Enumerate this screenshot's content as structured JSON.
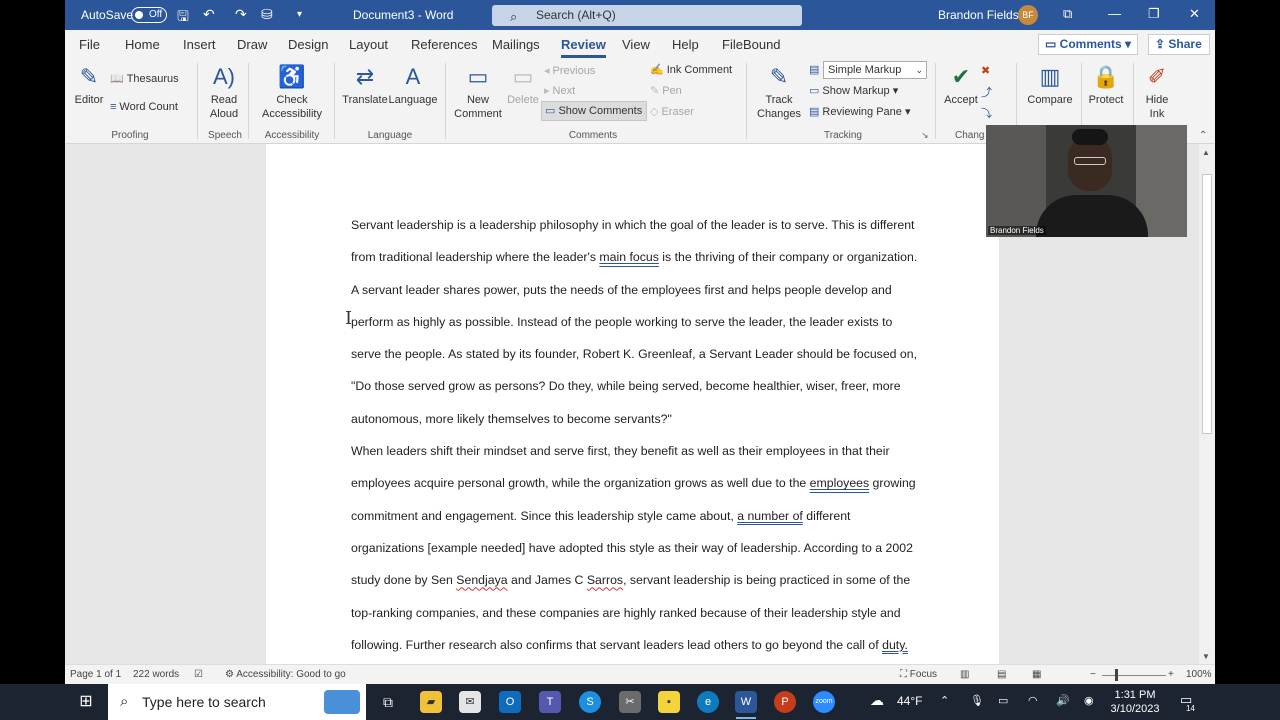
{
  "titlebar": {
    "autosave_label": "AutoSave",
    "autosave_state": "Off",
    "doc_title": "Document3 - Word",
    "search_placeholder": "Search (Alt+Q)",
    "user_name": "Brandon Fields",
    "user_initials": "BF"
  },
  "menu": {
    "tabs": [
      "File",
      "Home",
      "Insert",
      "Draw",
      "Design",
      "Layout",
      "References",
      "Mailings",
      "Review",
      "View",
      "Help",
      "FileBound"
    ],
    "active": "Review",
    "comments_label": "Comments",
    "share_label": "Share"
  },
  "ribbon": {
    "proofing": {
      "editor": "Editor",
      "thesaurus": "Thesaurus",
      "word_count": "Word Count",
      "group": "Proofing"
    },
    "speech": {
      "read_aloud_1": "Read",
      "read_aloud_2": "Aloud",
      "group": "Speech"
    },
    "accessibility": {
      "check_1": "Check",
      "check_2": "Accessibility",
      "group": "Accessibility"
    },
    "language": {
      "translate": "Translate",
      "language": "Language",
      "group": "Language"
    },
    "comments": {
      "new_1": "New",
      "new_2": "Comment",
      "delete": "Delete",
      "previous": "Previous",
      "next": "Next",
      "show_comments": "Show Comments",
      "ink_comment": "Ink Comment",
      "pen": "Pen",
      "eraser": "Eraser",
      "group": "Comments"
    },
    "tracking": {
      "track_1": "Track",
      "track_2": "Changes",
      "markup_mode": "Simple Markup",
      "show_markup": "Show Markup",
      "reviewing_pane": "Reviewing Pane",
      "group": "Tracking"
    },
    "changes": {
      "accept": "Accept",
      "group": "Chang"
    },
    "compare": {
      "label": "Compare"
    },
    "protect": {
      "label": "Protect"
    },
    "ink": {
      "hide_1": "Hide",
      "hide_2": "Ink"
    }
  },
  "document": {
    "para1_a": "Servant leadership is a leadership philosophy in which the goal of the leader is to serve. This is different from traditional leadership where the leader's ",
    "para1_b": "main focus",
    "para1_c": " is the thriving of their company or organization. A servant leader shares power, puts the needs of the employees first and helps people develop and perform as highly as possible. Instead of the people working to serve the leader, the leader exists to serve the people. As stated by its founder, Robert K. Greenleaf, a Servant Leader should be focused on, \"Do those served grow as persons? Do they, while being served, become healthier, wiser, freer, more autonomous, more likely themselves to become servants?\"",
    "para2_a": "When leaders shift their mindset and serve first, they benefit as well as their employees in that their employees acquire personal growth, while the organization grows as well due to the ",
    "para2_b": "employees",
    "para2_c": " growing commitment and engagement. Since this leadership style came about, ",
    "para2_d": "a number of",
    "para2_e": " different organizations [example needed] have adopted this style as their way of leadership. According to a 2002 study done by Sen ",
    "para2_f": "Sendjaya",
    "para2_g": " and James C ",
    "para2_h": "Sarros",
    "para2_i": ", servant leadership is being practiced in some of the top-ranking companies, and these companies are highly ranked because of their leadership style and following. Further research also confirms that servant leaders lead others to go beyond the call of ",
    "para2_j": "duty."
  },
  "webcam": {
    "name": "Brandon Fields"
  },
  "status": {
    "page": "Page 1 of 1",
    "words": "222 words",
    "accessibility": "Accessibility: Good to go",
    "focus": "Focus",
    "zoom": "100%"
  },
  "taskbar": {
    "search_placeholder": "Type here to search",
    "weather": "44°F",
    "time": "1:31 PM",
    "date": "3/10/2023",
    "notifications": "14"
  }
}
